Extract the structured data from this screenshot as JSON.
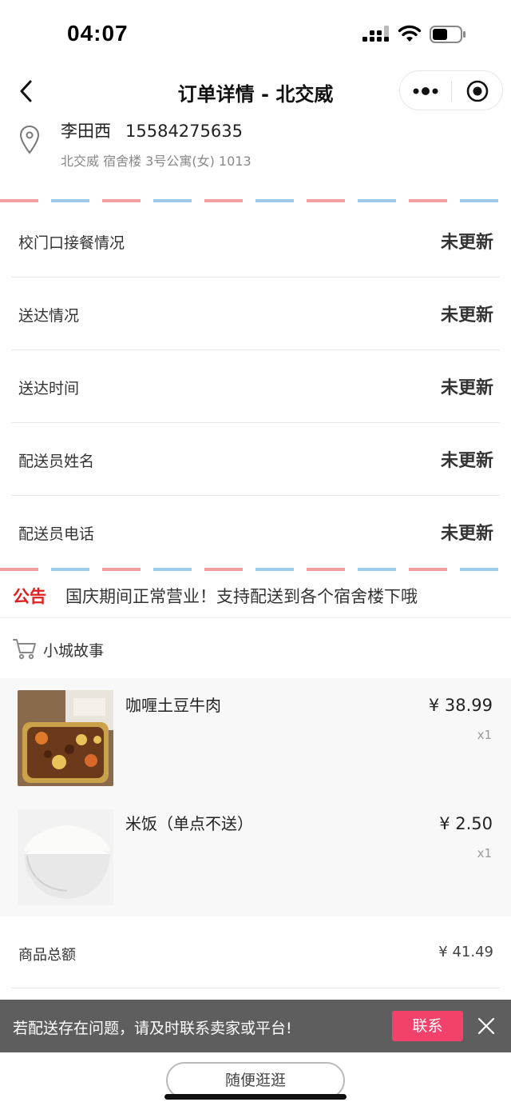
{
  "status_bar": {
    "time": "04:07"
  },
  "nav": {
    "title": "订单详情 - 北交威"
  },
  "address": {
    "name": "李田西",
    "phone": "15584275635",
    "detail": "北交威 宿舍楼 3号公寓(女) 1013"
  },
  "delivery_info": [
    {
      "label": "校门口接餐情况",
      "value": "未更新"
    },
    {
      "label": "送达情况",
      "value": "未更新"
    },
    {
      "label": "送达时间",
      "value": "未更新"
    },
    {
      "label": "配送员姓名",
      "value": "未更新"
    },
    {
      "label": "配送员电话",
      "value": "未更新"
    }
  ],
  "notice": {
    "tag": "公告",
    "text": "国庆期间正常营业！支持配送到各个宿舍楼下哦"
  },
  "shop": {
    "name": "小城故事"
  },
  "items": [
    {
      "name": "咖喱土豆牛肉",
      "price": "¥ 38.99",
      "qty": "x1"
    },
    {
      "name": "米饭（单点不送）",
      "price": "¥ 2.50",
      "qty": "x1"
    }
  ],
  "summary": [
    {
      "label": "商品总额",
      "value": "¥ 41.49"
    }
  ],
  "toast": {
    "text": "若配送存在问题，请及时联系卖家或平台!",
    "button_label": "联系"
  },
  "bottom": {
    "browse_label": "随便逛逛"
  },
  "colors": {
    "accent_red": "#e02020",
    "contact_button": "#f2416a",
    "toast_bg": "#5e5e5e",
    "airmail_red": "#f2a0a0",
    "airmail_blue": "#9cc9ee"
  }
}
